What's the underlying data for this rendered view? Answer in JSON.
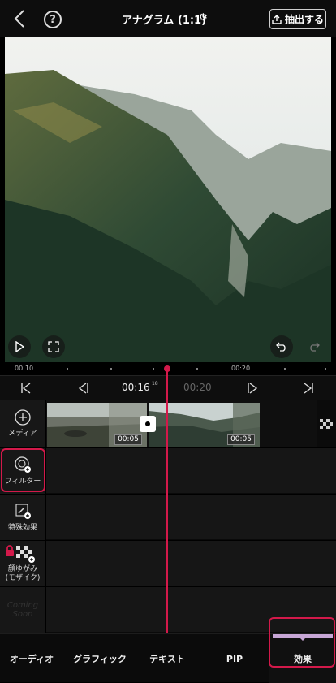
{
  "header": {
    "title": "アナグラム (1:1)",
    "export_label": "抽出する"
  },
  "ruler": {
    "t1": "00:10",
    "t2": "00:20"
  },
  "transport": {
    "current": "00:16",
    "frame": "18",
    "end": "00:20"
  },
  "clips": {
    "clip1_duration": "00:05",
    "clip2_duration": "00:05"
  },
  "sidebar": {
    "media": "メディア",
    "filter": "フィルター",
    "effects": "特殊効果",
    "mosaic_line1": "顔ゆがみ",
    "mosaic_line2": "(モザイク)",
    "coming_soon": "Coming Soon"
  },
  "tabs": {
    "audio": "オーディオ",
    "graphic": "グラフィック",
    "text": "テキスト",
    "pip": "PIP",
    "effect": "効果"
  },
  "colors": {
    "accent": "#d3194a",
    "tab_active_bar": "#c7a6d6"
  }
}
